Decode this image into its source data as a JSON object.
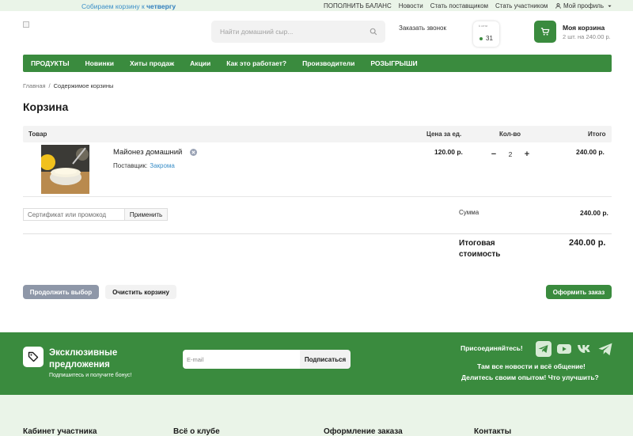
{
  "topbar": {
    "promo_prefix": "Собираем корзину к",
    "promo_day": "четвергу",
    "links": [
      "ПОПОЛНИТЬ БАЛАНС",
      "Новости",
      "Стать поставщиком",
      "Стать участником"
    ],
    "profile": "Мой профиль"
  },
  "header": {
    "search_placeholder": "Найти домашний сыр...",
    "callback": "Заказать звонок",
    "counter_tiny": "k сети",
    "counter_value": "31",
    "cart_title": "Моя корзина",
    "cart_summary": "2 шт. на 240.00 р."
  },
  "nav": [
    "ПРОДУКТЫ",
    "Новинки",
    "Хиты продаж",
    "Акции",
    "Как это работает?",
    "Производители",
    "РОЗЫГРЫШИ"
  ],
  "breadcrumb": {
    "home": "Главная",
    "sep": "/",
    "current": "Содержимое корзины"
  },
  "page_title": "Корзина",
  "table": {
    "headers": {
      "product": "Товар",
      "price": "Цена за ед.",
      "qty": "Кол-во",
      "total": "Итого"
    },
    "item": {
      "name": "Майонез домашний",
      "supplier_label": "Поставщик:",
      "supplier_name": "Закрома",
      "price": "120.00 р.",
      "qty_minus": "−",
      "qty": "2",
      "qty_plus": "+",
      "total": "240.00 р."
    }
  },
  "promo": {
    "placeholder": "Сертификат или промокод",
    "apply": "Применить"
  },
  "summary": {
    "sum_label": "Сумма",
    "sum_value": "240.00 р.",
    "grand_label": "Итоговая стоимость",
    "grand_value": "240.00 р."
  },
  "actions": {
    "continue": "Продолжить выбор",
    "clear": "Очистить корзину",
    "order": "Оформить заказ"
  },
  "subscribe": {
    "title": "Эксклюзивные предложения",
    "subtitle": "Подпишитесь и получите бонус!",
    "email_placeholder": "E-mail",
    "button": "Подписаться",
    "join": "Присоединяйтесь!",
    "line1": "Там все новости и всё общение!",
    "line2": "Делитесь своим опытом! Что улучшить?",
    "social_icons": [
      "telegram-icon",
      "youtube-icon",
      "vk-icon",
      "telegram-icon"
    ]
  },
  "footer": [
    "Кабинет участника",
    "Всё о клубе",
    "Оформление заказа",
    "Контакты"
  ],
  "colors": {
    "brand_green": "#3a8b3e",
    "link_blue": "#3b8fc8",
    "light_bg": "#eaf4e8",
    "muted_button": "#8e97a8"
  }
}
